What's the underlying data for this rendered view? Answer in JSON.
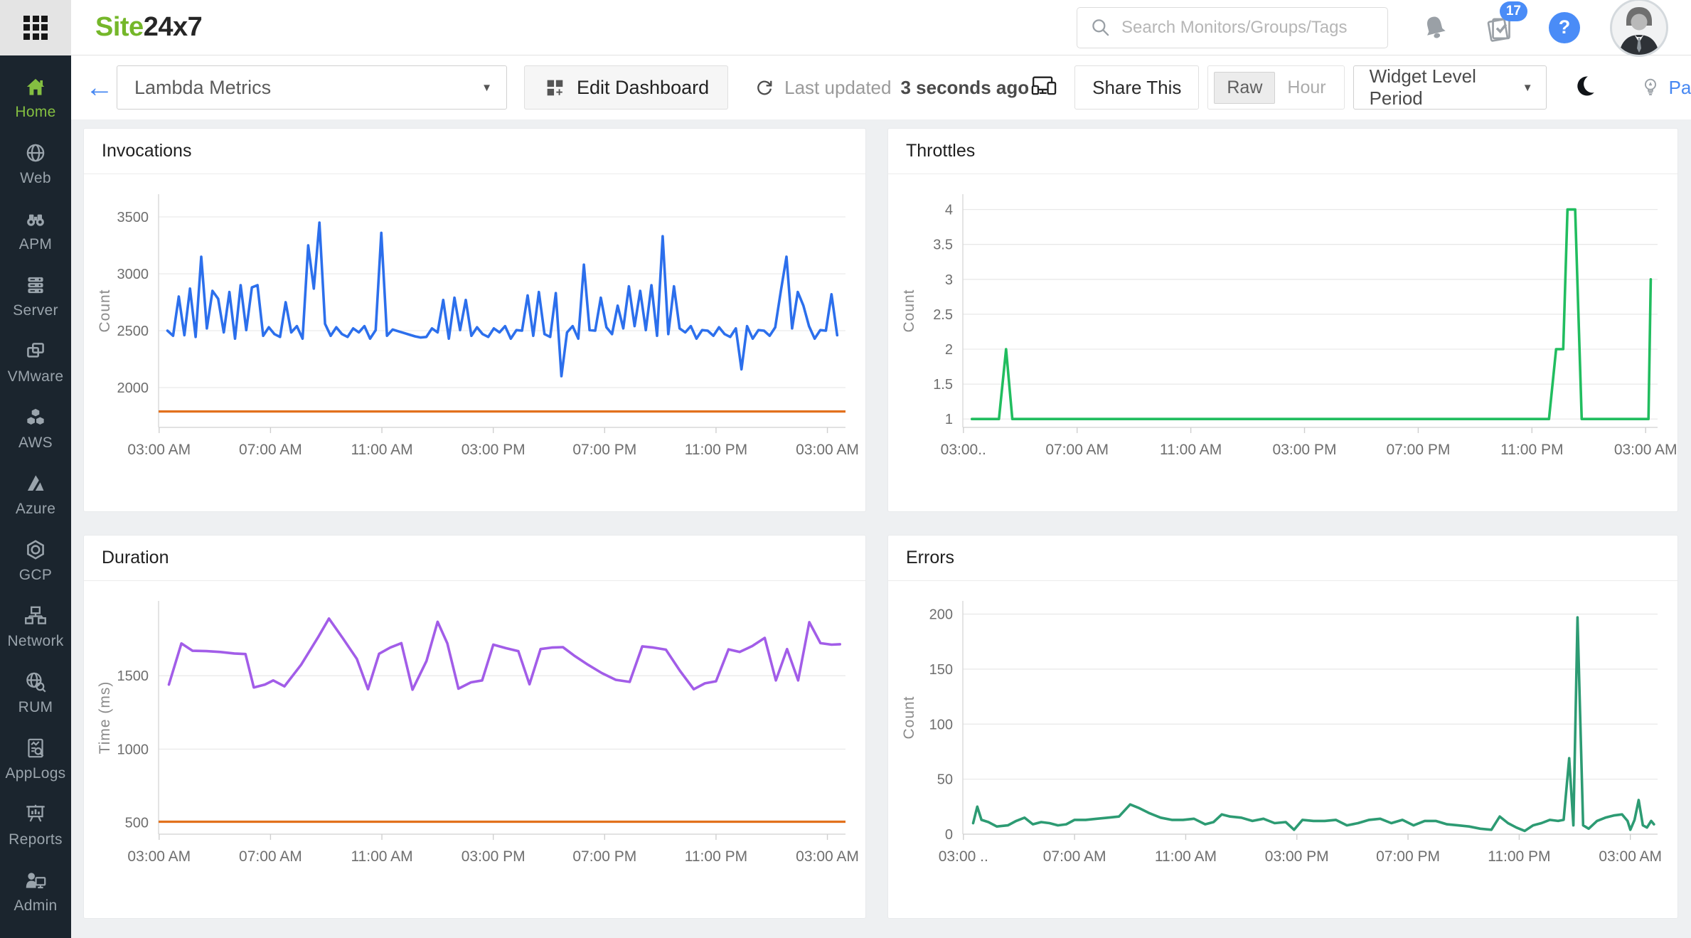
{
  "topbar": {
    "logo_prefix": "Site",
    "logo_suffix": "24x7",
    "search_placeholder": "Search Monitors/Groups/Tags",
    "task_badge": "17",
    "help_glyph": "?"
  },
  "sidebar": {
    "items": [
      {
        "label": "Home",
        "active": true
      },
      {
        "label": "Web",
        "active": false
      },
      {
        "label": "APM",
        "active": false
      },
      {
        "label": "Server",
        "active": false
      },
      {
        "label": "VMware",
        "active": false
      },
      {
        "label": "AWS",
        "active": false
      },
      {
        "label": "Azure",
        "active": false
      },
      {
        "label": "GCP",
        "active": false
      },
      {
        "label": "Network",
        "active": false
      },
      {
        "label": "RUM",
        "active": false
      },
      {
        "label": "AppLogs",
        "active": false
      },
      {
        "label": "Reports",
        "active": false
      },
      {
        "label": "Admin",
        "active": false
      }
    ]
  },
  "toolbar": {
    "dashboard_name": "Lambda Metrics",
    "edit_label": "Edit Dashboard",
    "last_updated_prefix": "Last updated",
    "last_updated_value": "3 seconds ago",
    "share_label": "Share This",
    "toggle": [
      {
        "label": "Raw",
        "active": true
      },
      {
        "label": "Hour",
        "active": false
      }
    ],
    "period_label": "Widget Level Period",
    "page_tips_label": "Page Tips",
    "caret_glyph": "▼"
  },
  "accent": {
    "blue": "#4788f2",
    "logo_green": "#75b72a",
    "sidebar_active_green": "#84bf41",
    "badge_blue": "#4a8cf7",
    "threshold_orange": "#e2711d"
  },
  "chart_data": [
    {
      "type": "line",
      "title": "Invocations",
      "ylabel": "Count",
      "color": "#2c6fec",
      "x_range": [
        2.98,
        27.65
      ],
      "y_range": [
        1650,
        3700
      ],
      "y_ticks": [
        2000,
        2500,
        3000,
        3500
      ],
      "x_ticks": [
        {
          "v": 3,
          "label": "03:00 AM"
        },
        {
          "v": 7,
          "label": "07:00 AM"
        },
        {
          "v": 11,
          "label": "11:00 AM"
        },
        {
          "v": 15,
          "label": "03:00 PM"
        },
        {
          "v": 19,
          "label": "07:00 PM"
        },
        {
          "v": 23,
          "label": "11:00 PM"
        },
        {
          "v": 27,
          "label": "03:00 AM"
        }
      ],
      "threshold": 1790,
      "series_x_start": 3.3,
      "series_x_end": 27.35,
      "values": [
        2500,
        2455,
        2800,
        2460,
        2870,
        2445,
        3150,
        2520,
        2850,
        2780,
        2485,
        2840,
        2430,
        2900,
        2505,
        2880,
        2900,
        2455,
        2530,
        2470,
        2445,
        2750,
        2485,
        2540,
        2430,
        3250,
        2870,
        3450,
        2560,
        2455,
        2530,
        2470,
        2445,
        2520,
        2485,
        2540,
        2430,
        2505,
        3360,
        2455,
        2510,
        2495,
        2480,
        2465,
        2450,
        2440,
        2445,
        2520,
        2485,
        2770,
        2430,
        2790,
        2505,
        2770,
        2455,
        2530,
        2470,
        2445,
        2520,
        2485,
        2540,
        2430,
        2505,
        2500,
        2810,
        2455,
        2840,
        2470,
        2445,
        2830,
        2100,
        2485,
        2540,
        2430,
        3080,
        2505,
        2500,
        2790,
        2530,
        2470,
        2720,
        2520,
        2890,
        2540,
        2850,
        2505,
        2900,
        2455,
        3330,
        2470,
        2890,
        2520,
        2485,
        2540,
        2430,
        2505,
        2500,
        2455,
        2530,
        2470,
        2445,
        2520,
        2160,
        2540,
        2430,
        2505,
        2500,
        2455,
        2530,
        2850,
        3150,
        2520,
        2840,
        2720,
        2540,
        2430,
        2505,
        2500,
        2820,
        2460
      ]
    },
    {
      "type": "line",
      "title": "Throttles",
      "ylabel": "Count",
      "color": "#21bd5f",
      "x_range": [
        2.98,
        27.42
      ],
      "y_range": [
        0.88,
        4.22
      ],
      "y_ticks": [
        1,
        1.5,
        2,
        2.5,
        3,
        3.5,
        4
      ],
      "x_ticks": [
        {
          "v": 3,
          "label": "03:00.."
        },
        {
          "v": 7,
          "label": "07:00 AM"
        },
        {
          "v": 11,
          "label": "11:00 AM"
        },
        {
          "v": 15,
          "label": "03:00 PM"
        },
        {
          "v": 19,
          "label": "07:00 PM"
        },
        {
          "v": 23,
          "label": "11:00 PM"
        },
        {
          "v": 27,
          "label": "03:00 AM"
        }
      ],
      "points": [
        [
          3.3,
          1
        ],
        [
          3.45,
          1
        ],
        [
          4.25,
          1
        ],
        [
          4.5,
          2
        ],
        [
          4.72,
          1
        ],
        [
          5.0,
          1
        ],
        [
          23.6,
          1
        ],
        [
          23.85,
          2
        ],
        [
          24.1,
          2
        ],
        [
          24.25,
          4
        ],
        [
          24.52,
          4
        ],
        [
          24.75,
          1
        ],
        [
          26.95,
          1
        ],
        [
          27.1,
          1
        ],
        [
          27.18,
          3
        ]
      ]
    },
    {
      "type": "line",
      "title": "Duration",
      "ylabel": "Time (ms)",
      "color": "#a25de8",
      "x_range": [
        2.98,
        27.65
      ],
      "y_range": [
        420,
        2010
      ],
      "y_ticks": [
        500,
        1000,
        1500
      ],
      "x_ticks": [
        {
          "v": 3,
          "label": "03:00 AM"
        },
        {
          "v": 7,
          "label": "07:00 AM"
        },
        {
          "v": 11,
          "label": "11:00 AM"
        },
        {
          "v": 15,
          "label": "03:00 PM"
        },
        {
          "v": 19,
          "label": "07:00 PM"
        },
        {
          "v": 23,
          "label": "11:00 PM"
        },
        {
          "v": 27,
          "label": "03:00 AM"
        }
      ],
      "threshold": 505,
      "points": [
        [
          3.35,
          1440
        ],
        [
          3.8,
          1720
        ],
        [
          4.2,
          1670
        ],
        [
          4.7,
          1668
        ],
        [
          5.2,
          1662
        ],
        [
          5.7,
          1652
        ],
        [
          6.1,
          1648
        ],
        [
          6.4,
          1420
        ],
        [
          6.8,
          1440
        ],
        [
          7.1,
          1468
        ],
        [
          7.5,
          1428
        ],
        [
          8.1,
          1575
        ],
        [
          8.7,
          1760
        ],
        [
          9.1,
          1890
        ],
        [
          9.6,
          1755
        ],
        [
          10.1,
          1615
        ],
        [
          10.5,
          1408
        ],
        [
          10.9,
          1650
        ],
        [
          11.3,
          1692
        ],
        [
          11.7,
          1722
        ],
        [
          12.1,
          1405
        ],
        [
          12.6,
          1600
        ],
        [
          13.0,
          1868
        ],
        [
          13.35,
          1720
        ],
        [
          13.75,
          1412
        ],
        [
          14.2,
          1455
        ],
        [
          14.6,
          1468
        ],
        [
          15.0,
          1712
        ],
        [
          15.45,
          1688
        ],
        [
          15.9,
          1668
        ],
        [
          16.3,
          1442
        ],
        [
          16.7,
          1682
        ],
        [
          17.1,
          1692
        ],
        [
          17.5,
          1695
        ],
        [
          17.9,
          1638
        ],
        [
          18.4,
          1575
        ],
        [
          18.9,
          1518
        ],
        [
          19.4,
          1472
        ],
        [
          19.9,
          1458
        ],
        [
          20.35,
          1700
        ],
        [
          20.75,
          1692
        ],
        [
          21.2,
          1678
        ],
        [
          21.7,
          1535
        ],
        [
          22.2,
          1408
        ],
        [
          22.6,
          1448
        ],
        [
          23.0,
          1462
        ],
        [
          23.45,
          1680
        ],
        [
          23.85,
          1662
        ],
        [
          24.3,
          1702
        ],
        [
          24.75,
          1758
        ],
        [
          25.15,
          1468
        ],
        [
          25.55,
          1682
        ],
        [
          25.95,
          1468
        ],
        [
          26.35,
          1865
        ],
        [
          26.75,
          1722
        ],
        [
          27.15,
          1712
        ],
        [
          27.45,
          1715
        ]
      ]
    },
    {
      "type": "line",
      "title": "Errors",
      "ylabel": "Count",
      "color": "#2d9b73",
      "x_range": [
        2.98,
        27.98
      ],
      "y_range": [
        0,
        212
      ],
      "y_ticks": [
        0,
        50,
        100,
        150,
        200
      ],
      "x_ticks": [
        {
          "v": 3,
          "label": "03:00 .."
        },
        {
          "v": 7,
          "label": "07:00 AM"
        },
        {
          "v": 11,
          "label": "11:00 AM"
        },
        {
          "v": 15,
          "label": "03:00 PM"
        },
        {
          "v": 19,
          "label": "07:00 PM"
        },
        {
          "v": 23,
          "label": "11:00 PM"
        },
        {
          "v": 27,
          "label": "03:00 AM"
        }
      ],
      "points": [
        [
          3.35,
          10
        ],
        [
          3.5,
          25
        ],
        [
          3.65,
          13
        ],
        [
          3.9,
          11
        ],
        [
          4.2,
          7
        ],
        [
          4.6,
          8
        ],
        [
          4.9,
          12
        ],
        [
          5.2,
          15
        ],
        [
          5.5,
          9
        ],
        [
          5.8,
          11
        ],
        [
          6.1,
          10
        ],
        [
          6.4,
          8
        ],
        [
          6.7,
          9
        ],
        [
          7.0,
          13
        ],
        [
          7.4,
          13
        ],
        [
          7.8,
          14
        ],
        [
          8.2,
          15
        ],
        [
          8.6,
          16
        ],
        [
          9.0,
          27
        ],
        [
          9.3,
          24
        ],
        [
          9.7,
          19
        ],
        [
          10.1,
          15
        ],
        [
          10.5,
          13
        ],
        [
          10.9,
          13
        ],
        [
          11.3,
          14
        ],
        [
          11.7,
          9
        ],
        [
          12.0,
          11
        ],
        [
          12.3,
          18
        ],
        [
          12.6,
          16
        ],
        [
          13.0,
          15
        ],
        [
          13.4,
          12
        ],
        [
          13.8,
          14
        ],
        [
          14.2,
          10
        ],
        [
          14.6,
          11
        ],
        [
          14.9,
          4
        ],
        [
          15.2,
          13
        ],
        [
          15.6,
          12
        ],
        [
          16.0,
          12
        ],
        [
          16.4,
          13
        ],
        [
          16.8,
          8
        ],
        [
          17.2,
          10
        ],
        [
          17.6,
          13
        ],
        [
          18.0,
          14
        ],
        [
          18.4,
          10
        ],
        [
          18.8,
          13
        ],
        [
          19.2,
          8
        ],
        [
          19.6,
          12
        ],
        [
          20.0,
          12
        ],
        [
          20.4,
          9
        ],
        [
          20.8,
          8
        ],
        [
          21.2,
          7
        ],
        [
          21.6,
          5
        ],
        [
          22.0,
          4
        ],
        [
          22.3,
          16
        ],
        [
          22.6,
          10
        ],
        [
          22.9,
          6
        ],
        [
          23.2,
          3
        ],
        [
          23.5,
          8
        ],
        [
          23.8,
          10
        ],
        [
          24.1,
          13
        ],
        [
          24.4,
          12
        ],
        [
          24.6,
          13
        ],
        [
          24.8,
          69
        ],
        [
          24.95,
          8
        ],
        [
          25.1,
          197
        ],
        [
          25.3,
          8
        ],
        [
          25.5,
          5
        ],
        [
          25.8,
          12
        ],
        [
          26.1,
          15
        ],
        [
          26.4,
          17
        ],
        [
          26.7,
          18
        ],
        [
          26.9,
          12
        ],
        [
          27.0,
          4
        ],
        [
          27.15,
          13
        ],
        [
          27.3,
          31
        ],
        [
          27.45,
          8
        ],
        [
          27.6,
          6
        ],
        [
          27.75,
          12
        ],
        [
          27.85,
          9
        ]
      ]
    }
  ]
}
